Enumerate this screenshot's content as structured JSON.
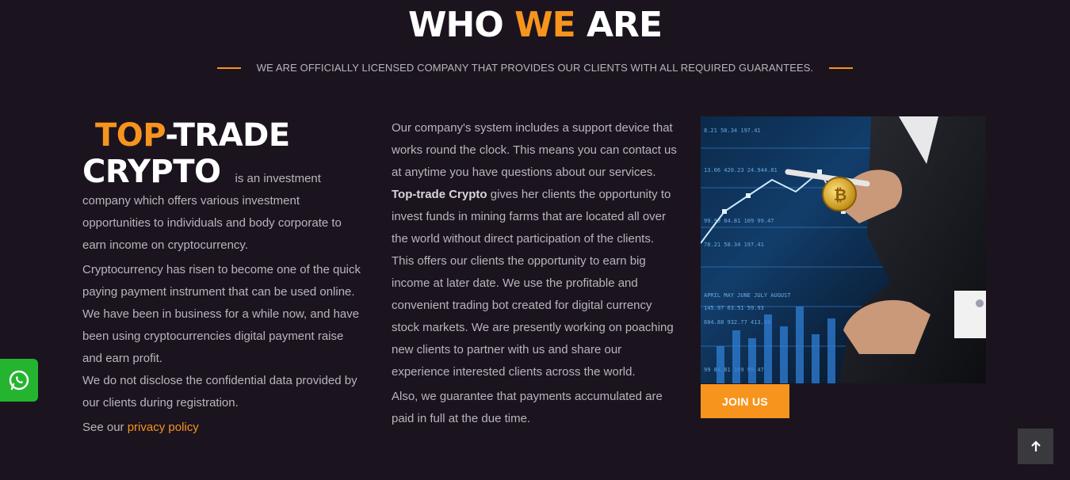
{
  "header": {
    "title_part1": "WHO ",
    "title_accent": "WE",
    "title_part2": " ARE",
    "subtitle": "WE ARE OFFICIALLY LICENSED COMPANY THAT PROVIDES OUR CLIENTS WITH ALL REQUIRED GUARANTEES."
  },
  "col1": {
    "brand_accent": "TOP",
    "brand_rest": "-TRADE",
    "brand_line2": "CRYPTO",
    "intro_tail": "is an investment",
    "intro_rest": "company which offers various investment opportunities to individuals and body corporate to earn income on cryptocurrency.",
    "para2": "Cryptocurrency has risen to become one of the quick paying payment instrument that can be used online. We have been in business for a while now, and have been using cryptocurrencies digital payment raise and earn profit.",
    "para3": "We do not disclose the confidential data provided by our clients during registration.",
    "privacy_prefix": "See our ",
    "privacy_link": "privacy policy"
  },
  "col2": {
    "para1_a": "Our company's system includes a support device that works round the clock. This means you can contact us at anytime you have questions about our services. ",
    "para1_bold": "Top-trade Crypto",
    "para1_b": " gives her clients the opportunity to invest funds in mining farms that are located all over the world without direct participation of the clients. This offers our clients the opportunity to earn big income at later date. We use the profitable and convenient trading bot created for digital currency stock markets. We are presently working on poaching new clients to partner with us and share our experience interested clients across the world.",
    "para2": "Also, we guarantee that payments accumulated are paid in full at the due time."
  },
  "col3": {
    "join_label": "JOIN US"
  },
  "widgets": {
    "whatsapp_icon": "whatsapp-icon",
    "back_to_top_icon": "arrow-up-icon"
  },
  "colors": {
    "background": "#1b141f",
    "accent": "#f7941d",
    "whatsapp": "#25b42f"
  }
}
